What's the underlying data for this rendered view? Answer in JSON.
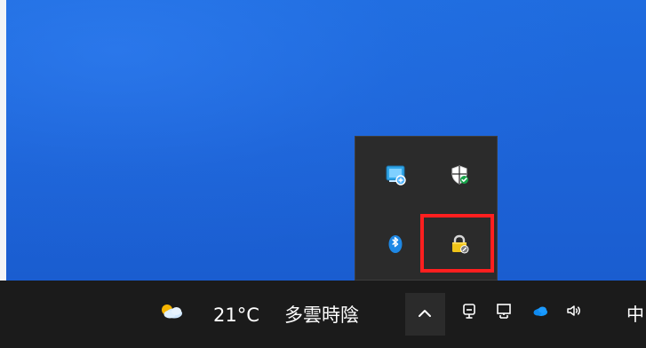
{
  "taskbar": {
    "weather": {
      "temperature": "21°C",
      "condition": "多雲時陰",
      "icon": "weather-partly-cloudy-icon"
    },
    "tray": {
      "overflow_button": "chevron-up-icon",
      "icons": [
        "mic-icon",
        "network-icon",
        "onedrive-icon",
        "volume-icon"
      ],
      "input_method": "中"
    }
  },
  "overflow_tray": {
    "icons": [
      "network-monitor-icon",
      "windows-security-icon",
      "bluetooth-icon",
      "bitlocker-lock-icon"
    ],
    "highlighted_icon": "bitlocker-lock-icon"
  },
  "colors": {
    "desktop": "#1d64d8",
    "taskbar": "#1b1b1b",
    "tray_flyout": "#2b2b2b",
    "highlight": "#ff1f1f"
  }
}
